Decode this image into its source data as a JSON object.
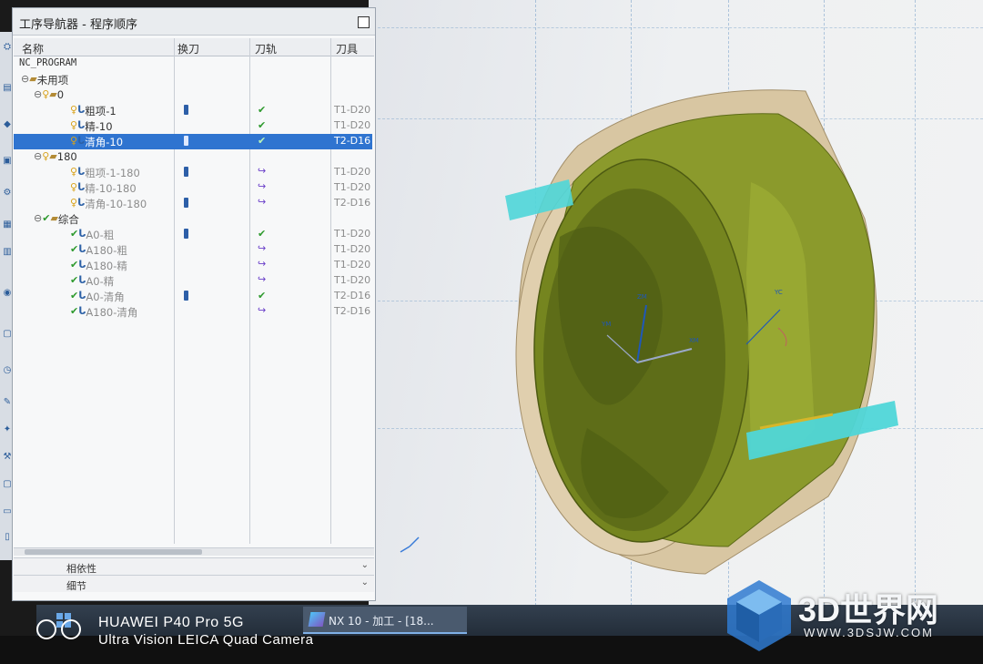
{
  "navigator": {
    "title": "工序导航器 - 程序顺序",
    "columns": [
      "名称",
      "换刀",
      "刀轨",
      "刀具"
    ],
    "root": "NC_PROGRAM",
    "rows": [
      {
        "name": "未用项",
        "level": 1,
        "kind": "folder",
        "tool": "",
        "toolchange": false,
        "path": ""
      },
      {
        "name": "0",
        "level": 2,
        "kind": "program",
        "tool": "",
        "toolchange": false,
        "path": ""
      },
      {
        "name": "粗项-1",
        "level": 3,
        "kind": "operation",
        "tool": "T1-D20",
        "toolchange": true,
        "path": "check"
      },
      {
        "name": "精-10",
        "level": 3,
        "kind": "operation",
        "tool": "T1-D20",
        "toolchange": false,
        "path": "check"
      },
      {
        "name": "清角-10",
        "level": 3,
        "kind": "operation",
        "tool": "T2-D16",
        "toolchange": true,
        "path": "check",
        "selected": true
      },
      {
        "name": "180",
        "level": 2,
        "kind": "program",
        "tool": "",
        "toolchange": false,
        "path": ""
      },
      {
        "name": "粗项-1-180",
        "level": 3,
        "kind": "operation",
        "tool": "T1-D20",
        "toolchange": true,
        "path": "regen"
      },
      {
        "name": "精-10-180",
        "level": 3,
        "kind": "operation",
        "tool": "T1-D20",
        "toolchange": false,
        "path": "regen"
      },
      {
        "name": "清角-10-180",
        "level": 3,
        "kind": "operation",
        "tool": "T2-D16",
        "toolchange": true,
        "path": "regen"
      },
      {
        "name": "综合",
        "level": 2,
        "kind": "program-done",
        "tool": "",
        "toolchange": false,
        "path": ""
      },
      {
        "name": "A0-粗",
        "level": 3,
        "kind": "operation-done",
        "tool": "T1-D20",
        "toolchange": true,
        "path": "check"
      },
      {
        "name": "A180-粗",
        "level": 3,
        "kind": "operation-done",
        "tool": "T1-D20",
        "toolchange": false,
        "path": "regen"
      },
      {
        "name": "A180-精",
        "level": 3,
        "kind": "operation-done",
        "tool": "T1-D20",
        "toolchange": false,
        "path": "regen"
      },
      {
        "name": "A0-精",
        "level": 3,
        "kind": "operation-done",
        "tool": "T1-D20",
        "toolchange": false,
        "path": "regen"
      },
      {
        "name": "A0-清角",
        "level": 3,
        "kind": "operation-done",
        "tool": "T2-D16",
        "toolchange": true,
        "path": "check"
      },
      {
        "name": "A180-清角",
        "level": 3,
        "kind": "operation-done",
        "tool": "T2-D16",
        "toolchange": false,
        "path": "regen"
      }
    ],
    "dependency_label": "相依性",
    "details_label": "细节"
  },
  "taskbar": {
    "active_window": "NX 10 - 加工 - [18..."
  },
  "viewport": {
    "axis_labels": {
      "zm": "ZM",
      "xm": "XM",
      "ym": "YM",
      "yc": "YC"
    }
  },
  "watermark": {
    "camera_line1": "HUAWEI P40 Pro 5G",
    "camera_line2": "Ultra Vision LEICA Quad Camera",
    "site_name": "3D世界网",
    "site_url": "WWW.3DSJW.COM"
  },
  "colors": {
    "selection": "#2f74d0",
    "part_green": "#8c9a2a",
    "stock_beige": "#d9c7a4",
    "tool_cyan": "#4fd6d8",
    "path_purple": "#6a3fc9",
    "check_green": "#2e9a2e"
  }
}
